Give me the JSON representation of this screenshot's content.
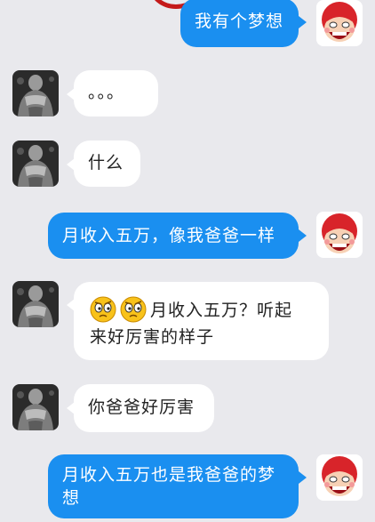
{
  "chat": {
    "messages": [
      {
        "side": "out",
        "text": "我有个梦想",
        "avatar": "cartoon-girl-avatar"
      },
      {
        "side": "in",
        "text": "。。。",
        "avatar": "muscle-man-avatar"
      },
      {
        "side": "in",
        "text": "什么",
        "avatar": "muscle-man-avatar"
      },
      {
        "side": "out",
        "text": "月收入五万，像我爸爸一样",
        "avatar": "cartoon-girl-avatar"
      },
      {
        "side": "in",
        "text": "月收入五万？听起来好厉害的样子",
        "line1": "月收入五万？听起",
        "line2": "来好厉害的样子",
        "emojis": [
          "confused-face-icon",
          "confused-face-icon"
        ],
        "avatar": "muscle-man-avatar"
      },
      {
        "side": "in",
        "text": "你爸爸好厉害",
        "avatar": "muscle-man-avatar"
      },
      {
        "side": "out",
        "text": "月收入五万也是我爸爸的梦想",
        "line1": "月收入五万也是我爸爸的梦",
        "line2": "想",
        "avatar": "cartoon-girl-avatar"
      }
    ]
  },
  "colors": {
    "background": "#e9e9ed",
    "outgoing_bubble": "#1a8ff0",
    "incoming_bubble": "#ffffff"
  }
}
